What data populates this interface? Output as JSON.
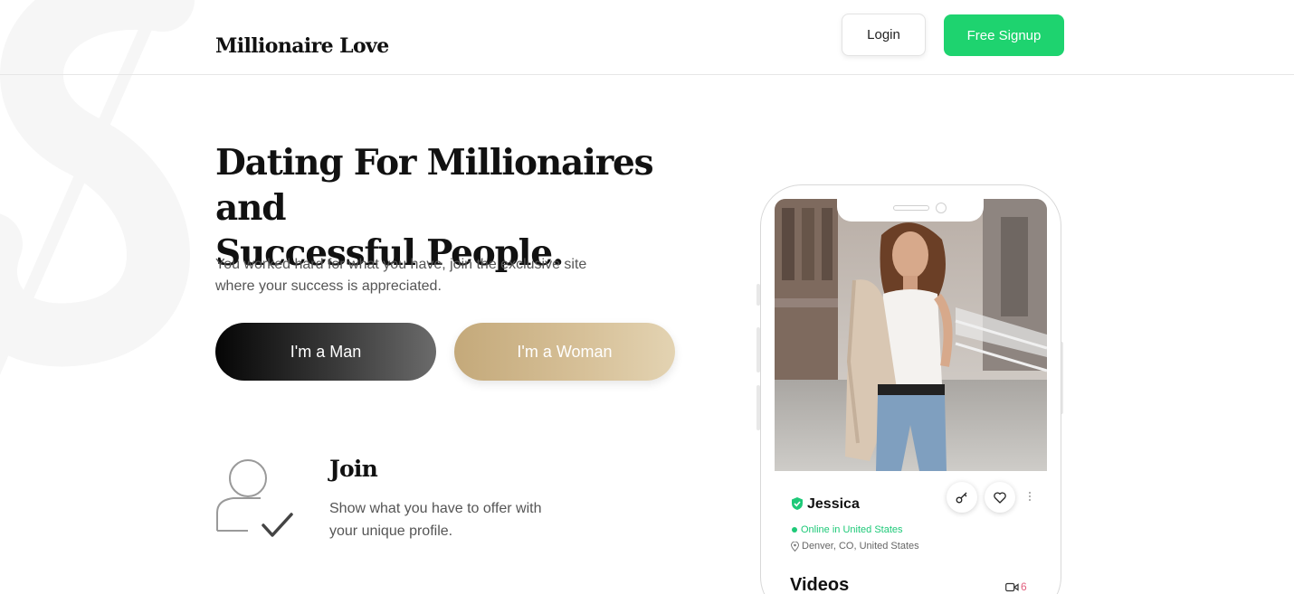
{
  "header": {
    "logo": "Millionaire Love",
    "login_label": "Login",
    "signup_label": "Free Signup"
  },
  "hero": {
    "title_line1": "Dating For Millionaires and",
    "title_line2": "Successful People.",
    "subtitle_line1": "You worked hard for what you have, join the exclusive site",
    "subtitle_line2": "where your success is appreciated.",
    "man_button": "I'm a Man",
    "woman_button": "I'm a Woman"
  },
  "feature": {
    "icon": "user-check-icon",
    "title": "Join",
    "text_line1": "Show what you have to offer with",
    "text_line2": "your unique profile."
  },
  "phone_profile": {
    "name": "Jessica",
    "status": "Online in United States",
    "location": "Denver, CO, United States",
    "videos_label": "Videos",
    "video_count": "6"
  },
  "colors": {
    "brand_green": "#1ed36f",
    "gold": "#c9b084",
    "online_green": "#1ec978",
    "video_count_pink": "#e2607f"
  }
}
